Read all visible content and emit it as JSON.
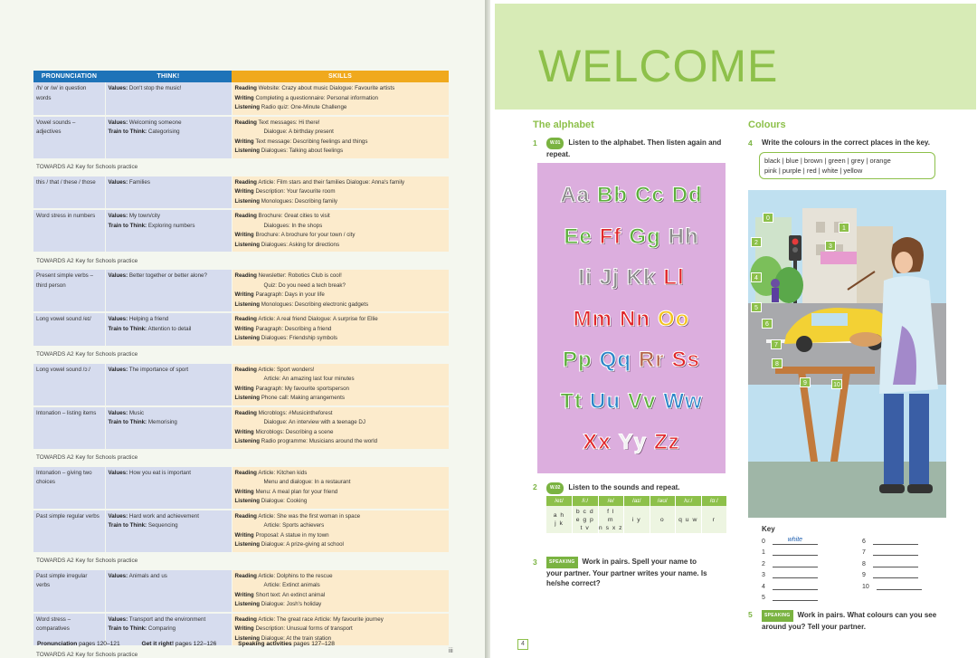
{
  "left_page": {
    "headers": {
      "pronunciation": "PRONUNCIATION",
      "think": "THINK!",
      "skills": "SKILLS"
    },
    "ket_label": "TOWARDS A2 Key for Schools practice",
    "rows": [
      {
        "pron": "/h/ or /w/ in question words",
        "think": [
          [
            "Values:",
            "Don't stop the music!"
          ]
        ],
        "skills": [
          [
            "Reading",
            "Website: Crazy about music    Dialogue: Favourite artists"
          ],
          [
            "Writing",
            "Completing a questionnaire: Personal information"
          ],
          [
            "Listening",
            "Radio quiz: One-Minute Challenge"
          ]
        ]
      },
      {
        "pron": "Vowel sounds – adjectives",
        "think": [
          [
            "Values:",
            "Welcoming someone"
          ],
          [
            "Train to Think:",
            "Categorising"
          ]
        ],
        "skills": [
          [
            "Reading",
            "Text messages: Hi there!"
          ],
          [
            "",
            "Dialogue: A birthday present"
          ],
          [
            "Writing",
            "Text message: Describing feelings and things"
          ],
          [
            "Listening",
            "Dialogues: Talking about feelings"
          ]
        ],
        "ket": true
      },
      {
        "pron": "this / that / these / those",
        "think": [
          [
            "Values:",
            "Families"
          ]
        ],
        "skills": [
          [
            "Reading",
            "Article: Film stars and their families    Dialogue: Anna's family"
          ],
          [
            "Writing",
            "Description: Your favourite room"
          ],
          [
            "Listening",
            "Monologues: Describing family"
          ]
        ]
      },
      {
        "pron": "Word stress in numbers",
        "think": [
          [
            "Values:",
            "My town/city"
          ],
          [
            "Train to Think:",
            "Exploring numbers"
          ]
        ],
        "skills": [
          [
            "Reading",
            "Brochure: Great cities to visit"
          ],
          [
            "",
            "Dialogues: In the shops"
          ],
          [
            "Writing",
            "Brochure: A brochure for your town / city"
          ],
          [
            "Listening",
            "Dialogues: Asking for directions"
          ]
        ],
        "ket": true
      },
      {
        "pron": "Present simple verbs – third person",
        "think": [
          [
            "Values:",
            "Better together or better alone?"
          ]
        ],
        "skills": [
          [
            "Reading",
            "Newsletter: Robotics Club is cool!"
          ],
          [
            "",
            "Quiz: Do you need a tech break?"
          ],
          [
            "Writing",
            "Paragraph: Days in your life"
          ],
          [
            "Listening",
            "Monologues: Describing electronic gadgets"
          ]
        ]
      },
      {
        "pron": "Long vowel sound /eɪ/",
        "think": [
          [
            "Values:",
            "Helping a friend"
          ],
          [
            "Train to Think:",
            "Attention to detail"
          ]
        ],
        "skills": [
          [
            "Reading",
            "Article: A real friend    Dialogue: A surprise for Ellie"
          ],
          [
            "Writing",
            "Paragraph: Describing a friend"
          ],
          [
            "Listening",
            "Dialogues: Friendship symbols"
          ]
        ],
        "ket": true
      },
      {
        "pron": "Long vowel sound /ɔː/",
        "think": [
          [
            "Values:",
            "The importance of sport"
          ]
        ],
        "skills": [
          [
            "Reading",
            "Article: Sport wonders!"
          ],
          [
            "",
            "Article: An amazing last four minutes"
          ],
          [
            "Writing",
            "Paragraph: My favourite sportsperson"
          ],
          [
            "Listening",
            "Phone call: Making arrangements"
          ]
        ]
      },
      {
        "pron": "Intonation – listing items",
        "think": [
          [
            "Values:",
            "Music"
          ],
          [
            "Train to Think:",
            "Memorising"
          ]
        ],
        "skills": [
          [
            "Reading",
            "Microblogs: #Musicintheforest"
          ],
          [
            "",
            "Dialogue: An interview with a teenage DJ"
          ],
          [
            "Writing",
            "Microblogs: Describing a scene"
          ],
          [
            "Listening",
            "Radio programme: Musicians around the world"
          ]
        ],
        "ket": true
      },
      {
        "pron": "Intonation – giving two choices",
        "think": [
          [
            "Values:",
            "How you eat is important"
          ]
        ],
        "skills": [
          [
            "Reading",
            "Article: Kitchen kids"
          ],
          [
            "",
            "Menu and dialogue: In a restaurant"
          ],
          [
            "Writing",
            "Menu: A meal plan for your friend"
          ],
          [
            "Listening",
            "Dialogue: Cooking"
          ]
        ]
      },
      {
        "pron": "Past simple regular verbs",
        "think": [
          [
            "Values:",
            "Hard work and achievement"
          ],
          [
            "Train to Think:",
            "Sequencing"
          ]
        ],
        "skills": [
          [
            "Reading",
            "Article: She was the first woman in space"
          ],
          [
            "",
            "Article: Sports achievers"
          ],
          [
            "Writing",
            "Proposal: A statue in my town"
          ],
          [
            "Listening",
            "Dialogue: A prize-giving at school"
          ]
        ],
        "ket": true
      },
      {
        "pron": "Past simple irregular verbs",
        "think": [
          [
            "Values:",
            "Animals and us"
          ]
        ],
        "skills": [
          [
            "Reading",
            "Article: Dolphins to the rescue"
          ],
          [
            "",
            "Article: Extinct animals"
          ],
          [
            "Writing",
            "Short text: An extinct animal"
          ],
          [
            "Listening",
            "Dialogue: Josh's holiday"
          ]
        ]
      },
      {
        "pron": "Word stress – comparatives",
        "think": [
          [
            "Values:",
            "Transport and the environment"
          ],
          [
            "Train to Think:",
            "Comparing"
          ]
        ],
        "skills": [
          [
            "Reading",
            "Article: The great race    Article: My favourite journey"
          ],
          [
            "Writing",
            "Description: Unusual forms of transport"
          ],
          [
            "Listening",
            "Dialogue: At the train station"
          ]
        ],
        "ket": true
      }
    ],
    "footer": [
      {
        "label": "Pronunciation",
        "pages": "pages 120–121"
      },
      {
        "label": "Get it right!",
        "pages": "pages 122–126"
      },
      {
        "label": "Speaking activities",
        "pages": "pages 127–128"
      }
    ],
    "page_number": "iii"
  },
  "right_page": {
    "title": "WELCOME",
    "alphabet_title": "The alphabet",
    "ex1": {
      "num": "1",
      "audio": "W.01",
      "text": "Listen to the alphabet. Then listen again and repeat."
    },
    "alphabet_rows": [
      [
        [
          "Aa",
          "#8a8a8a"
        ],
        [
          "Bb",
          "#5cae3b"
        ],
        [
          "Cc",
          "#5cae3b"
        ],
        [
          "Dd",
          "#5cae3b"
        ]
      ],
      [
        [
          "Ee",
          "#5cae3b"
        ],
        [
          "Ff",
          "#e0262a"
        ],
        [
          "Gg",
          "#5cae3b"
        ],
        [
          "Hh",
          "#8a8a8a"
        ]
      ],
      [
        [
          "Ii",
          "#8a8a8a"
        ],
        [
          "Jj",
          "#8a8a8a"
        ],
        [
          "Kk",
          "#8a8a8a"
        ],
        [
          "Ll",
          "#e0262a"
        ]
      ],
      [
        [
          "Mm",
          "#e0262a"
        ],
        [
          "Nn",
          "#e0262a"
        ],
        [
          "Oo",
          "#f3c31b"
        ]
      ],
      [
        [
          "Pp",
          "#5cae3b"
        ],
        [
          "Qq",
          "#2b86c8"
        ],
        [
          "Rr",
          "#b5654a"
        ],
        [
          "Ss",
          "#e0262a"
        ]
      ],
      [
        [
          "Tt",
          "#5cae3b"
        ],
        [
          "Uu",
          "#2b86c8"
        ],
        [
          "Vv",
          "#5cae3b"
        ],
        [
          "Ww",
          "#2b86c8"
        ]
      ],
      [
        [
          "Xx",
          "#e0262a"
        ],
        [
          "Yy",
          "#f0f0f0"
        ],
        [
          "Zz",
          "#e0262a"
        ]
      ]
    ],
    "ex2": {
      "num": "2",
      "audio": "W.02",
      "text": "Listen to the sounds and repeat."
    },
    "sounds": {
      "headers": [
        "/eɪ/",
        "/iː/",
        "/e/",
        "/aɪ/",
        "/əʊ/",
        "/uː/",
        "/ɑː/"
      ],
      "cells": [
        "a h\nj k",
        "b c d\ne g p\nt v",
        "f l\nm\nn s x z",
        "i y",
        "o",
        "q u w",
        "r"
      ]
    },
    "ex3": {
      "num": "3",
      "badge": "SPEAKING",
      "text": "Work in pairs. Spell your name to your partner. Your partner writes your name. Is he/she correct?"
    },
    "colours_title": "Colours",
    "ex4": {
      "num": "4",
      "text": "Write the colours in the correct places in the key."
    },
    "colours_box": {
      "line1": "black  |  blue  |  brown  |  green  |  grey  |  orange",
      "line2": "pink  |  purple  |  red  |  white  |  yellow"
    },
    "markers": [
      "0",
      "1",
      "2",
      "3",
      "4",
      "5",
      "6",
      "7",
      "8",
      "9",
      "10"
    ],
    "key_title": "Key",
    "key_left": [
      {
        "n": "0",
        "v": "white"
      },
      {
        "n": "1",
        "v": ""
      },
      {
        "n": "2",
        "v": ""
      },
      {
        "n": "3",
        "v": ""
      },
      {
        "n": "4",
        "v": ""
      },
      {
        "n": "5",
        "v": ""
      }
    ],
    "key_right": [
      {
        "n": "6",
        "v": ""
      },
      {
        "n": "7",
        "v": ""
      },
      {
        "n": "8",
        "v": ""
      },
      {
        "n": "9",
        "v": ""
      },
      {
        "n": "10",
        "v": ""
      }
    ],
    "ex5": {
      "num": "5",
      "badge": "SPEAKING",
      "text": "Work in pairs. What colours can you see around you? Tell your partner."
    },
    "page_number": "4",
    "colors": {
      "accent": "#8dc04a",
      "banner": "#d7ebb6",
      "alphabet_bg": "#dcaede",
      "pron_col": "#1e73b8",
      "skills_col": "#f0a91d"
    }
  }
}
